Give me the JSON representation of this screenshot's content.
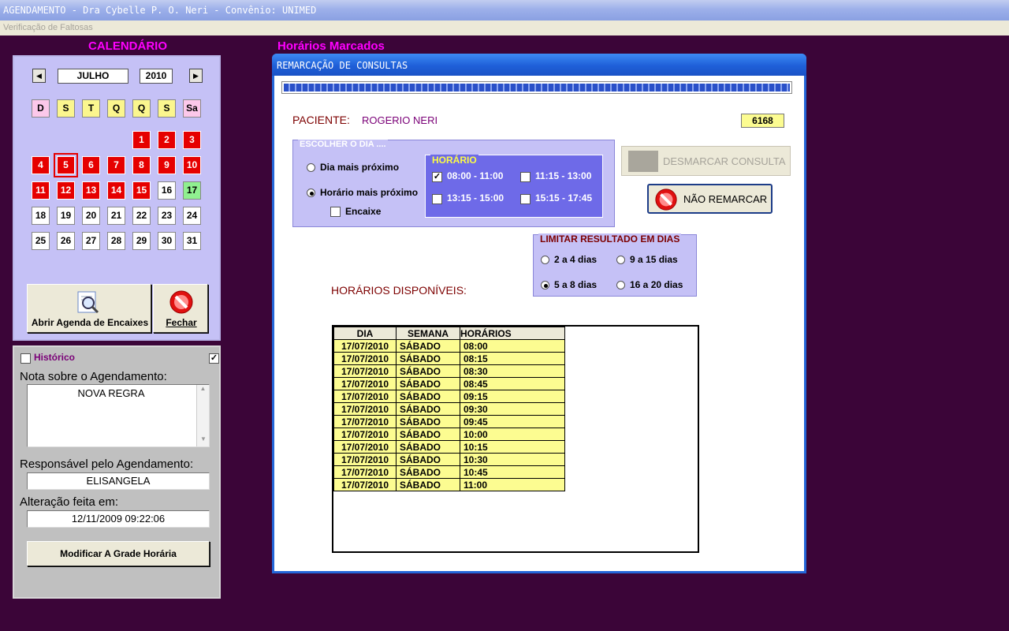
{
  "window": {
    "title": "AGENDAMENTO - Dra Cybelle P. O. Neri - Convênio: UNIMED",
    "menu": "Verificação de Faltosas"
  },
  "calendar": {
    "heading": "CALENDÁRIO",
    "month": "JULHO",
    "year": "2010",
    "weekdays": [
      "D",
      "S",
      "T",
      "Q",
      "Q",
      "S",
      "Sa"
    ],
    "selected_day": "5",
    "open_button": "Abrir Agenda de Encaixes",
    "close_button": "Fechar"
  },
  "left": {
    "historico_label": "Histórico",
    "nota_label": "Nota sobre o Agendamento:",
    "nota_value": "NOVA REGRA",
    "responsavel_label": "Responsável pelo Agendamento:",
    "responsavel_value": "ELISANGELA",
    "alteracao_label": "Alteração feita em:",
    "alteracao_value": "12/11/2009 09:22:06",
    "modify_button": "Modificar A Grade Horária"
  },
  "dialog": {
    "section_heading": "Horários Marcados",
    "title": "REMARCAÇÃO DE CONSULTAS",
    "paciente_label": "PACIENTE:",
    "paciente_name": "ROGERIO NERI",
    "paciente_id": "6168",
    "escolher_title": "ESCOLHER O DIA ....",
    "opt_dia": "Dia mais próximo",
    "opt_horario": "Horário mais próximo",
    "opt_encaixe": "Encaixe",
    "horario_title": "HORÁRIO",
    "slot1": "08:00 - 11:00",
    "slot2": "11:15 - 13:00",
    "slot3": "13:15 - 15:00",
    "slot4": "15:15 - 17:45",
    "desmarcar_button": "DESMARCAR CONSULTA",
    "nao_remarcar_button": "NÃO REMARCAR",
    "limitar_title": "LIMITAR RESULTADO EM DIAS",
    "lim1": "2 a 4 dias",
    "lim2": "9 a 15 dias",
    "lim3": "5 a 8 dias",
    "lim4": "16 a 20 dias",
    "disponiveis_label": "HORÁRIOS DISPONÍVEIS:",
    "table_headers": [
      "DIA",
      "SEMANA",
      "HORÁRIOS"
    ],
    "rows": [
      [
        "17/07/2010",
        "SÁBADO",
        "08:00"
      ],
      [
        "17/07/2010",
        "SÁBADO",
        "08:15"
      ],
      [
        "17/07/2010",
        "SÁBADO",
        "08:30"
      ],
      [
        "17/07/2010",
        "SÁBADO",
        "08:45"
      ],
      [
        "17/07/2010",
        "SÁBADO",
        "09:15"
      ],
      [
        "17/07/2010",
        "SÁBADO",
        "09:30"
      ],
      [
        "17/07/2010",
        "SÁBADO",
        "09:45"
      ],
      [
        "17/07/2010",
        "SÁBADO",
        "10:00"
      ],
      [
        "17/07/2010",
        "SÁBADO",
        "10:15"
      ],
      [
        "17/07/2010",
        "SÁBADO",
        "10:30"
      ],
      [
        "17/07/2010",
        "SÁBADO",
        "10:45"
      ],
      [
        "17/07/2010",
        "SÁBADO",
        "11:00"
      ]
    ]
  }
}
